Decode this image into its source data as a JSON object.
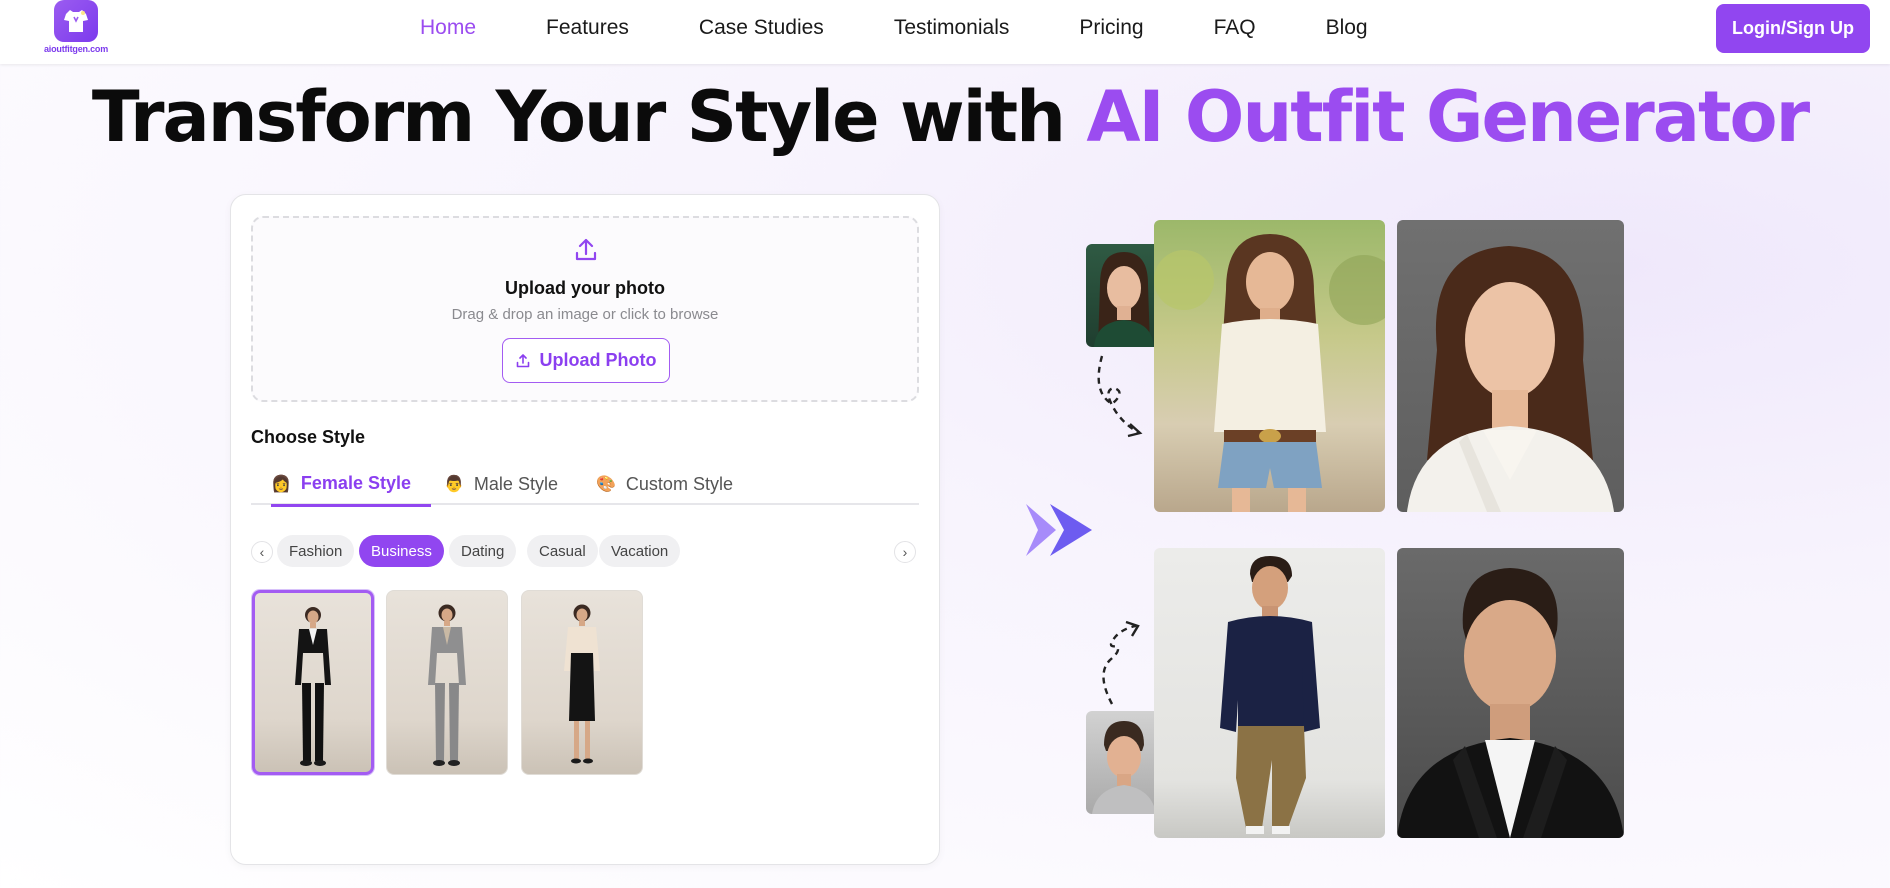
{
  "nav": {
    "logo_text": "aioutfitgen.com",
    "links": [
      {
        "label": "Home",
        "active": true
      },
      {
        "label": "Features"
      },
      {
        "label": "Case Studies"
      },
      {
        "label": "Testimonials"
      },
      {
        "label": "Pricing"
      },
      {
        "label": "FAQ"
      },
      {
        "label": "Blog"
      }
    ],
    "login_label": "Login/Sign Up"
  },
  "hero": {
    "title_part1": "Transform Your Style with ",
    "title_accent": "AI Outfit Generator"
  },
  "upload": {
    "title": "Upload your photo",
    "subtitle": "Drag & drop an image or click to browse",
    "button_label": "Upload Photo"
  },
  "style": {
    "heading": "Choose Style",
    "tabs": [
      {
        "emoji": "👩",
        "label": "Female Style",
        "active": true
      },
      {
        "emoji": "👨",
        "label": "Male Style"
      },
      {
        "emoji": "🎨",
        "label": "Custom Style"
      }
    ],
    "chips": [
      {
        "label": "Fashion"
      },
      {
        "label": "Business",
        "active": true
      },
      {
        "label": "Dating"
      },
      {
        "label": "Casual"
      },
      {
        "label": "Vacation"
      }
    ],
    "prev_arrow": "‹",
    "next_arrow": "›",
    "selected_thumbnail": 0
  },
  "colors": {
    "accent": "#9146f0",
    "accent_text": "#9b4cf0"
  },
  "icons": [
    "logo-shirt-icon",
    "upload-icon",
    "chevron-left-icon",
    "chevron-right-icon",
    "double-chevron-icon",
    "dashed-arrow-icon"
  ]
}
